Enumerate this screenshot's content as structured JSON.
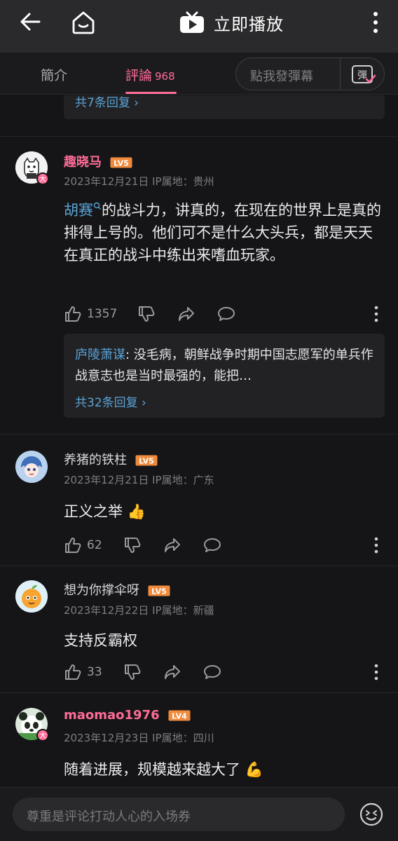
{
  "header": {
    "play_label": "立即播放"
  },
  "tabs": {
    "intro": "簡介",
    "comments": "評論",
    "comments_count": "968"
  },
  "danmaku": {
    "placeholder": "點我發彈幕",
    "icon_char": "彈"
  },
  "prev_thread": {
    "more_replies": "共7条回复 ›"
  },
  "comments": [
    {
      "username": "趣晓马",
      "level": "LV5",
      "badge": "大",
      "meta": "2023年12月21日  IP属地：贵州",
      "text_link": "胡赛",
      "text_rest": "的战斗力，讲真的，在现在的世界上是真的排得上号的。他们可不是什么大头兵，都是天天在真正的战斗中练出来嗜血玩家。",
      "likes": "1357",
      "reply": {
        "name": "庐陵萧谋",
        "text": "没毛病，朝鲜战争时期中国志愿军的单兵作战意志也是当时最强的，能把…",
        "more": "共32条回复 ›"
      }
    },
    {
      "username": "养猪的铁柱",
      "level": "LV5",
      "meta": "2023年12月21日  IP属地：广东",
      "text": "正义之举 👍",
      "likes": "62"
    },
    {
      "username": "想为你撑伞呀",
      "level": "LV5",
      "meta": "2023年12月22日  IP属地：新疆",
      "text": "支持反霸权",
      "likes": "33"
    },
    {
      "username": "maomao1976",
      "level": "LV4",
      "badge": "大",
      "meta": "2023年12月23日  IP属地：四川",
      "text": "随着进展，规模越来越大了 💪"
    }
  ],
  "bottom": {
    "placeholder": "尊重是评论打动人心的入场券"
  },
  "colors": {
    "accent": "#ff6c98",
    "link": "#5aa3d6",
    "background": "#151517",
    "level_badge": "#f08a3c"
  }
}
